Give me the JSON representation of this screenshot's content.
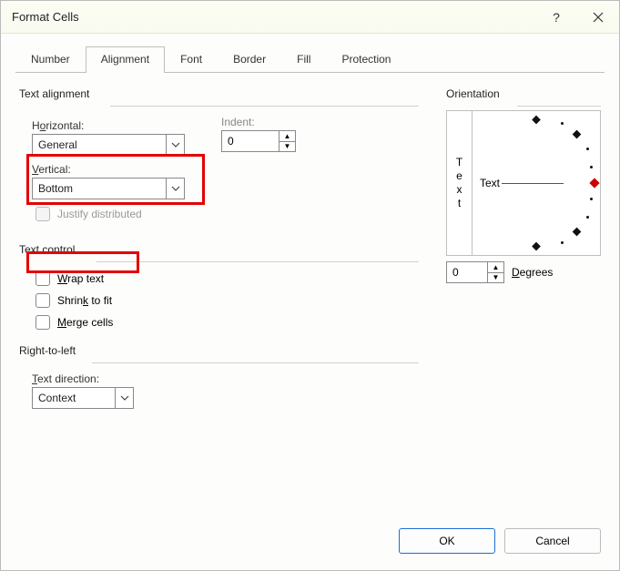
{
  "title": "Format Cells",
  "tabs": [
    "Number",
    "Alignment",
    "Font",
    "Border",
    "Fill",
    "Protection"
  ],
  "active_tab": 1,
  "text_alignment": {
    "group": "Text alignment",
    "horizontal_label_pre": "H",
    "horizontal_label_ul": "o",
    "horizontal_label_post": "rizontal:",
    "horizontal_value": "General",
    "vertical_label_ul": "V",
    "vertical_label_post": "ertical:",
    "vertical_value": "Bottom",
    "justify_label": "Justify distributed",
    "indent_label": "Indent:",
    "indent_value": "0"
  },
  "text_control": {
    "group": "Text control",
    "wrap_ul": "W",
    "wrap_post": "rap text",
    "shrink_label_pre": "Shrin",
    "shrink_ul": "k",
    "shrink_post": " to fit",
    "merge_ul": "M",
    "merge_post": "erge cells"
  },
  "rtl": {
    "group": "Right-to-left",
    "dir_ul": "T",
    "dir_post": "ext direction:",
    "dir_value": "Context"
  },
  "orientation": {
    "group": "Orientation",
    "vtext": [
      "T",
      "e",
      "x",
      "t"
    ],
    "text_label": "Text",
    "degrees_value": "0",
    "degrees_ul": "D",
    "degrees_post": "egrees"
  },
  "footer": {
    "ok": "OK",
    "cancel": "Cancel"
  }
}
